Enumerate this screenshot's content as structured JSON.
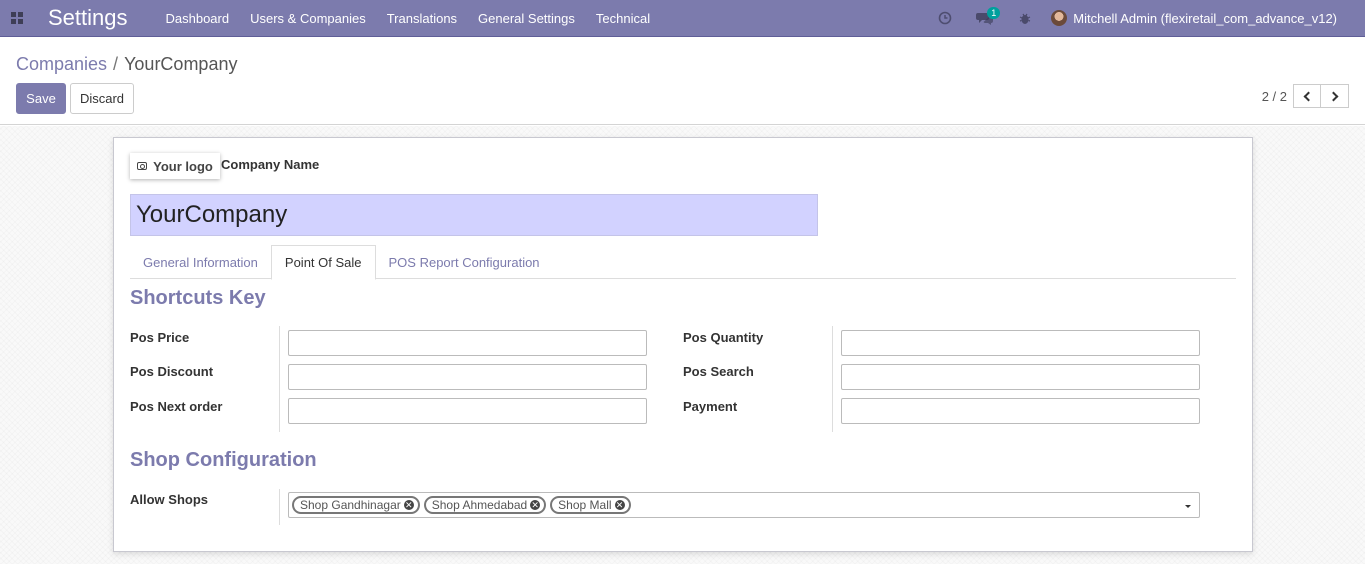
{
  "navbar": {
    "app_title": "Settings",
    "menu": [
      "Dashboard",
      "Users & Companies",
      "Translations",
      "General Settings",
      "Technical"
    ],
    "messages_badge": "1",
    "user_name": "Mitchell Admin (flexiretail_com_advance_v12)",
    "bg_color": "#7c7bad"
  },
  "breadcrumb": {
    "parent": "Companies",
    "separator": "/",
    "current": "YourCompany"
  },
  "toolbar": {
    "save_label": "Save",
    "discard_label": "Discard"
  },
  "pager": {
    "value": "2 / 2"
  },
  "form": {
    "logo_label": "Your logo",
    "company_name_label": "Company Name",
    "company_name_value": "YourCompany",
    "tabs": [
      "General Information",
      "Point Of Sale",
      "POS Report Configuration"
    ],
    "active_tab": "Point Of Sale",
    "shortcuts_title": "Shortcuts Key",
    "shortcut_fields": {
      "left": [
        "Pos Price",
        "Pos Discount",
        "Pos Next order"
      ],
      "right": [
        "Pos Quantity",
        "Pos Search",
        "Payment"
      ]
    },
    "shop_config_title": "Shop Configuration",
    "allow_shops_label": "Allow Shops",
    "shop_tags": [
      "Shop Gandhinagar",
      "Shop Ahmedabad",
      "Shop Mall"
    ]
  }
}
